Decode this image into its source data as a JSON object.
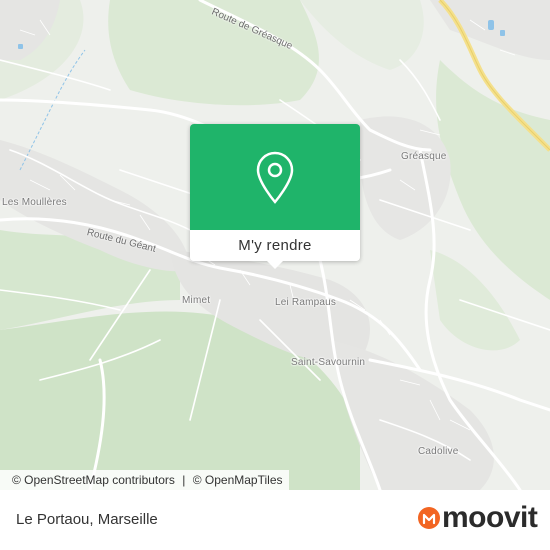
{
  "map": {
    "places": {
      "les_moulieres": "Les Moullères",
      "greasque": "Gréasque",
      "mimet": "Mimet",
      "lei_rampaus": "Lei Rampaus",
      "saint_savournin": "Saint-Savournin",
      "cadolive": "Cadolive"
    },
    "roads": {
      "route_de_greasque": "Route de Gréasque",
      "route_du_geant": "Route du Géant"
    },
    "attribution": {
      "osm": "© OpenStreetMap contributors",
      "separator": "|",
      "omt": "© OpenMapTiles"
    },
    "colors": {
      "background": "#eef0ec",
      "forest": "#d9e8d2",
      "urban": "#e3e3e3",
      "road": "#ffffff",
      "motorway": "#f4e08c",
      "water": "#8fc3e8"
    }
  },
  "popup": {
    "directions_label": "M'y rendre",
    "pin_icon": "location-pin-icon",
    "color": "#1fb46a"
  },
  "footer": {
    "stop_name": "Le Portaou, Marseille",
    "brand": "moovit",
    "brand_color": "#f26522"
  }
}
